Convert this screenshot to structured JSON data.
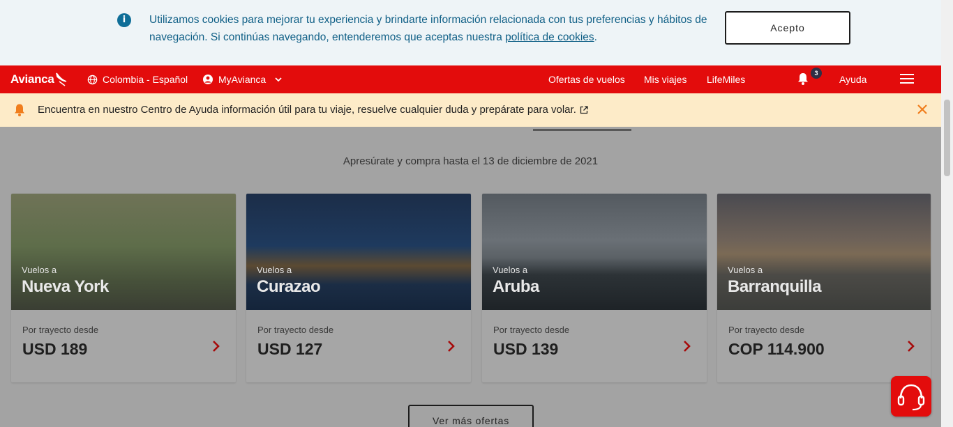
{
  "cookie_banner": {
    "text": "Utilizamos cookies para mejorar tu experiencia y brindarte información relacionada con tus preferencias y hábitos de navegación. Si continúas navegando, entenderemos que aceptas nuestra ",
    "link": "política de cookies",
    "trailing": ".",
    "accept_label": "Acepto",
    "info_glyph": "i"
  },
  "nav": {
    "logo": "Avianca",
    "country": "Colombia - Español",
    "account": "MyAvianca",
    "links": [
      "Ofertas de vuelos",
      "Mis viajes",
      "LifeMiles"
    ],
    "notification_count": "3",
    "help": "Ayuda"
  },
  "help_banner": {
    "text": "Encuentra en nuestro Centro de Ayuda información útil para tu viaje, resuelve cualquier duda y prepárate para volar."
  },
  "offers": {
    "subtitle": "Apresúrate y compra hasta el 13 de diciembre de 2021",
    "cards": [
      {
        "pre": "Vuelos a",
        "destination": "Nueva York",
        "from_label": "Por trayecto desde",
        "price": "USD 189"
      },
      {
        "pre": "Vuelos a",
        "destination": "Curazao",
        "from_label": "Por trayecto desde",
        "price": "USD 127"
      },
      {
        "pre": "Vuelos a",
        "destination": "Aruba",
        "from_label": "Por trayecto desde",
        "price": "USD 139"
      },
      {
        "pre": "Vuelos a",
        "destination": "Barranquilla",
        "from_label": "Por trayecto desde",
        "price": "COP 114.900"
      }
    ],
    "more_label": "Ver más ofertas"
  },
  "colors": {
    "brand_red": "#e30c0c",
    "cookie_text": "#0f5f86",
    "help_banner_bg": "#fdebc8",
    "alert_orange": "#f07d1c"
  },
  "icons": [
    "info-icon",
    "globe-icon",
    "user-icon",
    "chevron-down-icon",
    "bell-icon",
    "menu-icon",
    "external-link-icon",
    "close-icon",
    "chevron-right-icon",
    "headset-icon"
  ]
}
